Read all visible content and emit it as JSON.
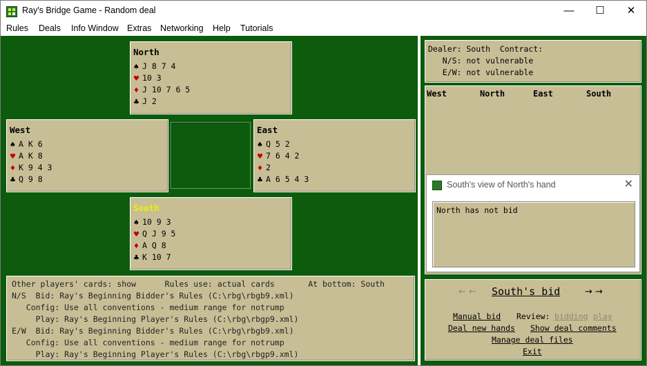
{
  "window": {
    "title": "Ray's Bridge Game - Random deal",
    "minimize": "—",
    "maximize": "☐",
    "close": "✕"
  },
  "menu": [
    "Rules",
    "Deals",
    "Info Window",
    "Extras",
    "Networking",
    "Help",
    "Tutorials"
  ],
  "hands": {
    "north": {
      "name": "North",
      "spades": "J 8 7 4",
      "hearts": "10 3",
      "diamonds": "J 10 7 6 5",
      "clubs": "J 2"
    },
    "west": {
      "name": "West",
      "spades": "A K 6",
      "hearts": "A K 8",
      "diamonds": "K 9 4 3",
      "clubs": "Q 9 8"
    },
    "east": {
      "name": "East",
      "spades": "Q 5 2",
      "hearts": "7 6 4 2",
      "diamonds": "2",
      "clubs": "A 6 5 4 3"
    },
    "south": {
      "name": "South",
      "spades": "10 9 3",
      "hearts": "Q J 9 5",
      "diamonds": "A Q 8",
      "clubs": "K 10 7"
    }
  },
  "suits": {
    "spade": "♠",
    "heart": "♥",
    "diamond": "♦",
    "club": "♣"
  },
  "info": {
    "line1": "Other players' cards: show      Rules use: actual cards       At bottom: South",
    "line2": "N/S  Bid: Ray's Beginning Bidder's Rules (C:\\rbg\\rbgb9.xml)",
    "line3": "   Config: Use all conventions - medium range for notrump",
    "line4": "     Play: Ray's Beginning Player's Rules (C:\\rbg\\rbgp9.xml)",
    "line5": "E/W  Bid: Ray's Beginning Bidder's Rules (C:\\rbg\\rbgb9.xml)",
    "line6": "   Config: Use all conventions - medium range for notrump",
    "line7": "     Play: Ray's Beginning Player's Rules (C:\\rbg\\rbgp9.xml)"
  },
  "status": {
    "line1": "Dealer: South  Contract:",
    "line2": "   N/S: not vulnerable",
    "line3": "   E/W: not vulnerable"
  },
  "bidding": {
    "cols": [
      "West",
      "North",
      "East",
      "South"
    ]
  },
  "dialog": {
    "title": "South's view of North's hand",
    "body": "North has not bid",
    "close": "✕"
  },
  "controls": {
    "prev_arrows": "←  ←",
    "next_arrows": "→  →",
    "heading": "South's bid",
    "manual_bid": "Manual bid",
    "review_label": "Review:",
    "review_bidding": "bidding",
    "review_play": "play",
    "deal_new_hands": "Deal new hands",
    "show_deal_comments": "Show deal comments",
    "manage_deal_files": "Manage deal files",
    "exit": "Exit"
  },
  "colors": {
    "table_green": "#0d5c0d",
    "panel_tan": "#c8be96",
    "south_highlight": "#f0f000",
    "red_suit": "#c00000"
  }
}
